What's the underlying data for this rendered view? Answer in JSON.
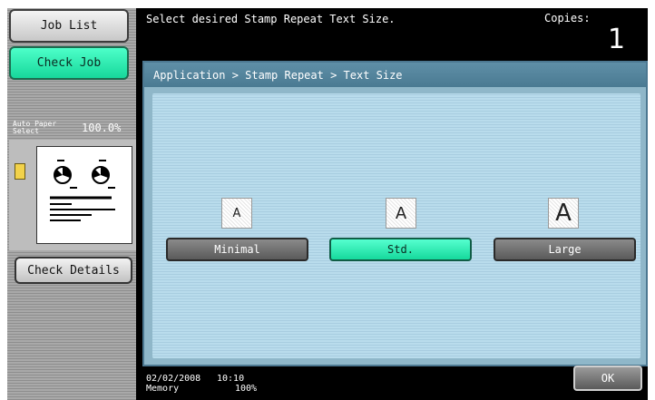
{
  "sidebar": {
    "job_list_label": "Job List",
    "check_job_label": "Check Job",
    "paper_label": "Auto Paper Select",
    "zoom": "100.0%",
    "check_details_label": "Check Details"
  },
  "header": {
    "message": "Select desired Stamp Repeat Text Size.",
    "copies_label": "Copies:",
    "copies_value": "1"
  },
  "panel": {
    "breadcrumb": "Application > Stamp Repeat > Text Size",
    "options": [
      {
        "icon_letter": "A",
        "label": "Minimal",
        "selected": false
      },
      {
        "icon_letter": "A",
        "label": "Std.",
        "selected": true
      },
      {
        "icon_letter": "A",
        "label": "Large",
        "selected": false
      }
    ]
  },
  "footer": {
    "date": "02/02/2008",
    "time": "10:10",
    "memory_label": "Memory",
    "memory_value": "100%",
    "ok_label": "OK"
  },
  "colors": {
    "selected": "#16d99c",
    "panel": "#b9dcec",
    "header": "#4a7a92"
  }
}
